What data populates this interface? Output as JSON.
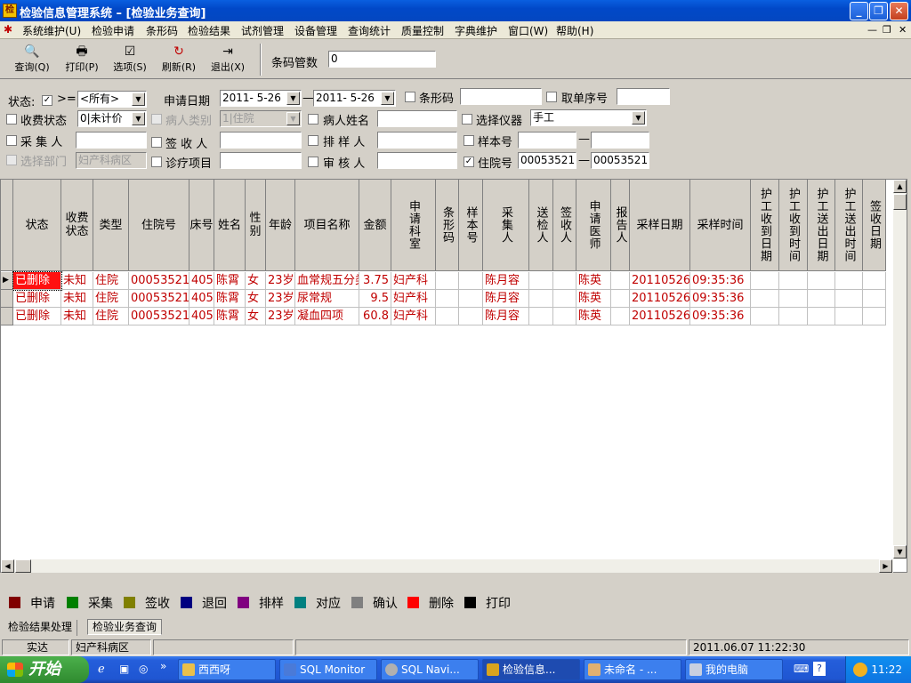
{
  "window": {
    "title": "检验信息管理系统 – [检验业务查询]"
  },
  "menu": [
    "系统维护(U)",
    "检验申请",
    "条形码",
    "检验结果",
    "试剂管理",
    "设备管理",
    "查询统计",
    "质量控制",
    "字典维护",
    "窗口(W)",
    "帮助(H)"
  ],
  "toolbar": {
    "buttons": [
      {
        "label": "查询(Q)",
        "icon": "magnifier-icon"
      },
      {
        "label": "打印(P)",
        "icon": "printer-icon"
      },
      {
        "label": "选项(S)",
        "icon": "options-icon"
      },
      {
        "label": "刷新(R)",
        "icon": "refresh-icon"
      },
      {
        "label": "退出(X)",
        "icon": "exit-icon"
      }
    ],
    "barcode_label": "条码管数",
    "barcode_value": "0"
  },
  "filters": {
    "status_label": "状态:",
    "status_op": ">=",
    "status_value": "<所有>",
    "apply_date_label": "申请日期",
    "date_from": "2011- 5-26",
    "date_to": "2011- 5-26",
    "dash": "—",
    "barcode_label": "条形码",
    "barcode_value": "",
    "pickup_label": "取单序号",
    "pickup_value": "",
    "fee_status_label": "收费状态",
    "fee_status_value": "0|未计价",
    "patient_type_label": "病人类别",
    "patient_type_value": "1|住院",
    "patient_name_label": "病人姓名",
    "patient_name_value": "",
    "instrument_label": "选择仪器",
    "instrument_value": "手工",
    "collector_label": "采 集 人",
    "collector_value": "",
    "signer_label": "签 收 人",
    "signer_value": "",
    "sorter_label": "排 样 人",
    "sorter_value": "",
    "sample_label": "样本号",
    "sample_from": "",
    "sample_to": "",
    "dept_label": "选择部门",
    "dept_value": "妇产科病区",
    "item_label": "诊疗项目",
    "item_value": "",
    "reviewer_label": "审 核 人",
    "reviewer_value": "",
    "inpatient_label": "住院号",
    "inpatient_from": "00053521",
    "inpatient_to": "00053521"
  },
  "grid": {
    "columns": [
      "状态",
      "收费状态",
      "类型",
      "住院号",
      "床号",
      "姓名",
      "性别",
      "年龄",
      "项目名称",
      "金额",
      "申请科室",
      "条形码",
      "样本号",
      "采集人",
      "送检人",
      "签收人",
      "申请医师",
      "报告人",
      "采样日期",
      "采样时间",
      "护工收到日期",
      "护工收到时间",
      "护工送出日期",
      "护工送出时间",
      "签收日期"
    ],
    "rows": [
      [
        "已删除",
        "未知",
        "住院",
        "00053521",
        "405",
        "陈霄",
        "女",
        "23岁",
        "血常规五分类",
        "3.75",
        "妇产科",
        "",
        "",
        "陈月容",
        "",
        "",
        "陈英",
        "",
        "20110526",
        "09:35:36",
        "",
        "",
        "",
        "",
        ""
      ],
      [
        "已删除",
        "未知",
        "住院",
        "00053521",
        "405",
        "陈霄",
        "女",
        "23岁",
        "尿常规",
        "9.5",
        "妇产科",
        "",
        "",
        "陈月容",
        "",
        "",
        "陈英",
        "",
        "20110526",
        "09:35:36",
        "",
        "",
        "",
        "",
        ""
      ],
      [
        "已删除",
        "未知",
        "住院",
        "00053521",
        "405",
        "陈霄",
        "女",
        "23岁",
        "凝血四项",
        "60.8",
        "妇产科",
        "",
        "",
        "陈月容",
        "",
        "",
        "陈英",
        "",
        "20110526",
        "09:35:36",
        "",
        "",
        "",
        "",
        ""
      ]
    ]
  },
  "legend": [
    {
      "label": "申请",
      "color": "#800000"
    },
    {
      "label": "采集",
      "color": "#008000"
    },
    {
      "label": "签收",
      "color": "#808000"
    },
    {
      "label": "退回",
      "color": "#000080"
    },
    {
      "label": "排样",
      "color": "#800080"
    },
    {
      "label": "对应",
      "color": "#008080"
    },
    {
      "label": "确认",
      "color": "#808080"
    },
    {
      "label": "删除",
      "color": "#ff0000"
    },
    {
      "label": "打印",
      "color": "#000000"
    }
  ],
  "tabs": [
    "检验结果处理",
    "检验业务查询"
  ],
  "status": {
    "user": "实达",
    "dept": "妇产科病区",
    "datetime": "2011.06.07 11:22:30"
  },
  "taskbar": {
    "start": "开始",
    "tasks": [
      "西西呀",
      "SQL Monitor",
      "SQL Navi...",
      "检验信息...",
      "未命名 - ...",
      "我的电脑"
    ],
    "clock": "11:22"
  }
}
